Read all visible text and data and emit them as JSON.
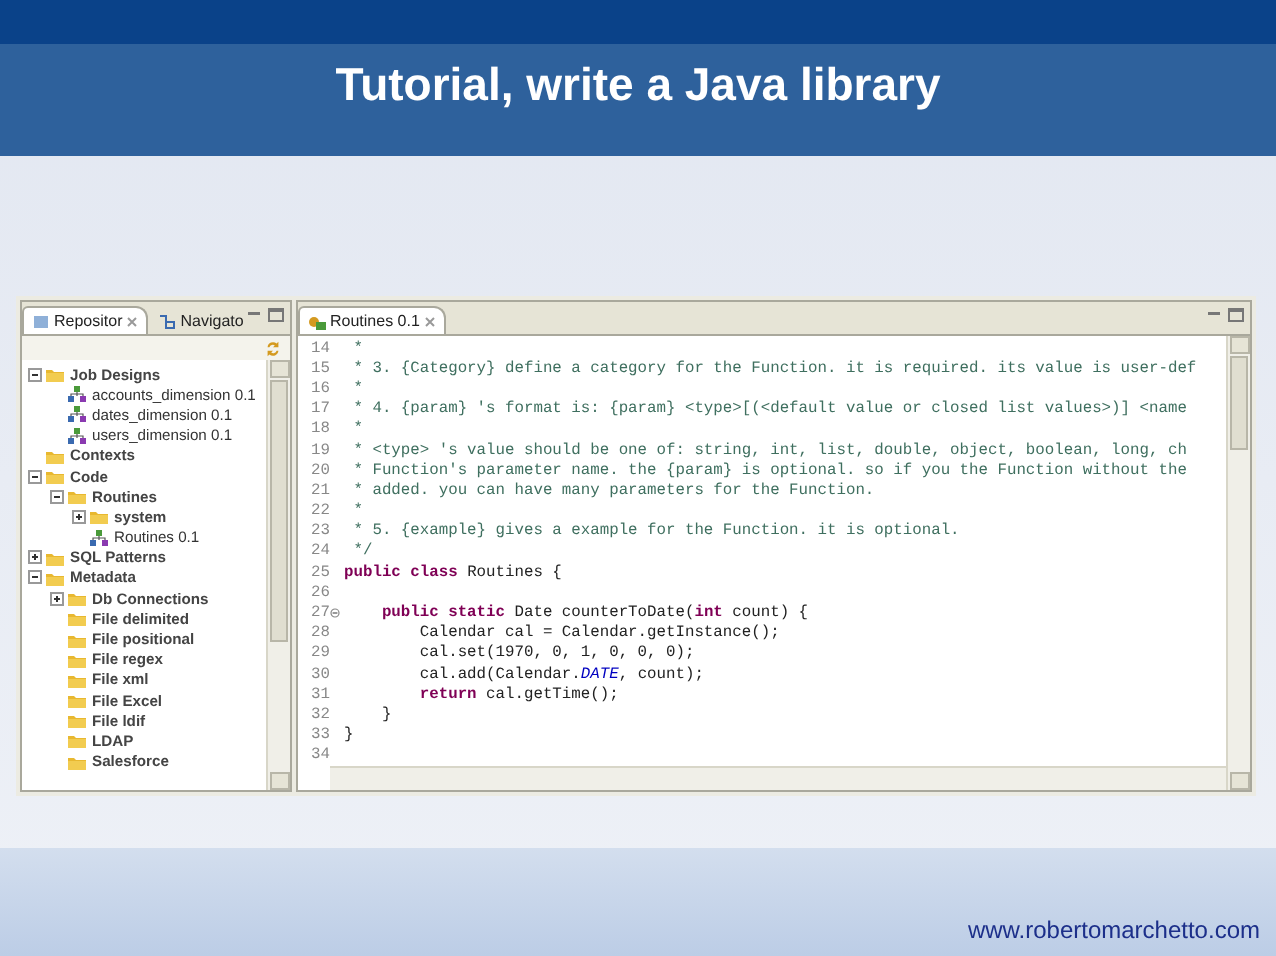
{
  "slide": {
    "title": "Tutorial, write a Java library",
    "footer_url": "www.robertomarchetto.com"
  },
  "repository_view": {
    "tabs": [
      {
        "label": "Repositor",
        "selected": true
      },
      {
        "label": "Navigato",
        "selected": false
      }
    ],
    "tree": [
      {
        "label": "Job Designs",
        "kind": "node",
        "expanded": true,
        "children": [
          {
            "label": "accounts_dimension 0.1",
            "kind": "item"
          },
          {
            "label": "dates_dimension 0.1",
            "kind": "item"
          },
          {
            "label": "users_dimension 0.1",
            "kind": "item"
          }
        ]
      },
      {
        "label": "Contexts",
        "kind": "node"
      },
      {
        "label": "Code",
        "kind": "node",
        "expanded": true,
        "children": [
          {
            "label": "Routines",
            "kind": "node",
            "expanded": true,
            "children": [
              {
                "label": "system",
                "kind": "node",
                "expanded": false
              },
              {
                "label": "Routines 0.1",
                "kind": "item"
              }
            ]
          }
        ]
      },
      {
        "label": "SQL Patterns",
        "kind": "node",
        "expanded": false
      },
      {
        "label": "Metadata",
        "kind": "node",
        "expanded": true,
        "children": [
          {
            "label": "Db Connections",
            "kind": "node",
            "expanded": false
          },
          {
            "label": "File delimited",
            "kind": "node"
          },
          {
            "label": "File positional",
            "kind": "node"
          },
          {
            "label": "File regex",
            "kind": "node"
          },
          {
            "label": "File xml",
            "kind": "node"
          },
          {
            "label": "File Excel",
            "kind": "node"
          },
          {
            "label": "File ldif",
            "kind": "node"
          },
          {
            "label": "LDAP",
            "kind": "node"
          },
          {
            "label": "Salesforce",
            "kind": "node"
          }
        ]
      }
    ]
  },
  "editor": {
    "tabs": [
      {
        "label": "Routines 0.1",
        "selected": true
      }
    ],
    "lines": [
      {
        "number": "14",
        "segments": [
          {
            "kind": "comment",
            "text": " *"
          }
        ]
      },
      {
        "number": "15",
        "segments": [
          {
            "kind": "comment",
            "text": " * 3. {Category} define a category for the Function. it is required. its value is user-def"
          }
        ]
      },
      {
        "number": "16",
        "segments": [
          {
            "kind": "comment",
            "text": " *"
          }
        ]
      },
      {
        "number": "17",
        "segments": [
          {
            "kind": "comment",
            "text": " * 4. {param} 's format is: {param} <type>[(<default value or closed list values>)] <name"
          }
        ]
      },
      {
        "number": "18",
        "segments": [
          {
            "kind": "comment",
            "text": " *"
          }
        ]
      },
      {
        "number": "19",
        "segments": [
          {
            "kind": "comment",
            "text": " * <type> 's value should be one of: string, int, list, double, object, boolean, long, ch"
          }
        ]
      },
      {
        "number": "20",
        "segments": [
          {
            "kind": "comment",
            "text": " * Function's parameter name. the {param} is optional. so if you the Function without the"
          }
        ]
      },
      {
        "number": "21",
        "segments": [
          {
            "kind": "comment",
            "text": " * added. you can have many parameters for the Function."
          }
        ]
      },
      {
        "number": "22",
        "segments": [
          {
            "kind": "comment",
            "text": " *"
          }
        ]
      },
      {
        "number": "23",
        "segments": [
          {
            "kind": "comment",
            "text": " * 5. {example} gives a example for the Function. it is optional."
          }
        ]
      },
      {
        "number": "24",
        "segments": [
          {
            "kind": "comment",
            "text": " */"
          }
        ]
      },
      {
        "number": "25",
        "segments": [
          {
            "kind": "keyword",
            "text": "public class"
          },
          {
            "kind": "code",
            "text": " Routines {"
          }
        ]
      },
      {
        "number": "26"
      },
      {
        "number": "27",
        "fold_marker": true,
        "segments": [
          {
            "kind": "keyword",
            "text": "    public static"
          },
          {
            "kind": "code",
            "text": " Date counterToDate("
          },
          {
            "kind": "keyword",
            "text": "int"
          },
          {
            "kind": "code",
            "text": " count) {"
          }
        ]
      },
      {
        "number": "28",
        "segments": [
          {
            "kind": "code",
            "text": "        Calendar cal = Calendar.getInstance();"
          }
        ]
      },
      {
        "number": "29",
        "segments": [
          {
            "kind": "code",
            "text": "        cal.set(1970, 0, 1, 0, 0, 0);"
          }
        ]
      },
      {
        "number": "30",
        "segments": [
          {
            "kind": "code",
            "text": "        cal.add(Calendar."
          },
          {
            "kind": "constant",
            "text": "DATE"
          },
          {
            "kind": "code",
            "text": ", count);"
          }
        ]
      },
      {
        "number": "31",
        "segments": [
          {
            "kind": "keyword",
            "text": "        return"
          },
          {
            "kind": "code",
            "text": " cal.getTime();"
          }
        ]
      },
      {
        "number": "32",
        "segments": [
          {
            "kind": "code",
            "text": "    }"
          }
        ]
      },
      {
        "number": "33",
        "segments": [
          {
            "kind": "code",
            "text": "}"
          }
        ]
      },
      {
        "number": "34"
      }
    ]
  }
}
